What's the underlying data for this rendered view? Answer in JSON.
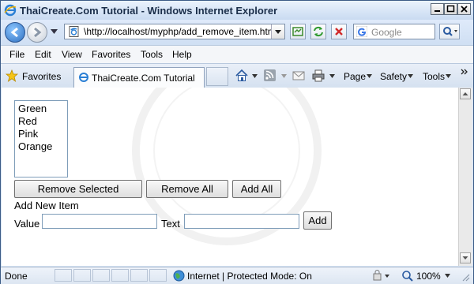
{
  "window": {
    "title": "ThaiCreate.Com Tutorial - Windows Internet Explorer"
  },
  "address_bar": {
    "url": "\\http://localhost/myphp/add_remove_item.html",
    "search_placeholder": "Google"
  },
  "menu": {
    "items": [
      "File",
      "Edit",
      "View",
      "Favorites",
      "Tools",
      "Help"
    ]
  },
  "favorites_bar": {
    "favorites_label": "Favorites",
    "tab_label": "ThaiCreate.Com Tutorial",
    "page_menu": "Page",
    "safety_menu": "Safety",
    "tools_menu": "Tools"
  },
  "page": {
    "list_options": [
      "Green",
      "Red",
      "Pink",
      "Orange"
    ],
    "remove_selected_label": "Remove Selected",
    "remove_all_label": "Remove All",
    "add_all_label": "Add All",
    "add_new_item_label": "Add New Item",
    "value_label": "Value",
    "value_input": "",
    "text_label": "Text",
    "text_input": "",
    "add_label": "Add"
  },
  "status_bar": {
    "status": "Done",
    "zone": "Internet | Protected Mode: On",
    "zoom": "100%"
  }
}
